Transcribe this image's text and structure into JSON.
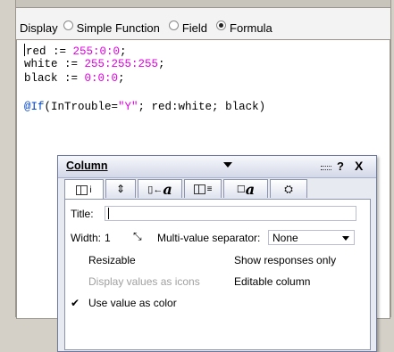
{
  "display": {
    "label": "Display",
    "options": [
      {
        "label": "Simple Function",
        "selected": false
      },
      {
        "label": "Field",
        "selected": false
      },
      {
        "label": "Formula",
        "selected": true
      }
    ]
  },
  "formula": {
    "line1": {
      "name": "red",
      "op": " := ",
      "value": "255:0:0",
      "end": ";"
    },
    "line2": {
      "name": "white",
      "op": " := ",
      "value": "255:255:255",
      "end": ";"
    },
    "line3": {
      "name": "black",
      "op": " := ",
      "value": "0:0:0",
      "end": ";"
    },
    "line4": {
      "fn": "@If",
      "open": "(InTrouble=",
      "str": "\"Y\"",
      "rest": "; red:white; black)"
    }
  },
  "panel": {
    "title": "Column",
    "help": "?",
    "close": "X",
    "tab_icons": [
      "column-info-icon",
      "sorting-icon",
      "font-icon",
      "numbers-icon",
      "title-font-icon",
      "advanced-icon"
    ],
    "title_label": "Title:",
    "title_value": "",
    "width_label": "Width:",
    "width_value": "1",
    "separator_label": "Multi-value separator:",
    "separator_value": "None",
    "resizable_label": "Resizable",
    "resizable_checked": false,
    "show_responses_label": "Show responses only",
    "show_responses_checked": false,
    "icons_label": "Display values as icons",
    "icons_checked": false,
    "editable_label": "Editable column",
    "editable_checked": false,
    "color_label": "Use value as color",
    "color_checked": true
  },
  "colors": {
    "number": "#e000e0",
    "function": "#0044cc",
    "panel_bg": "#e8eaf2"
  }
}
